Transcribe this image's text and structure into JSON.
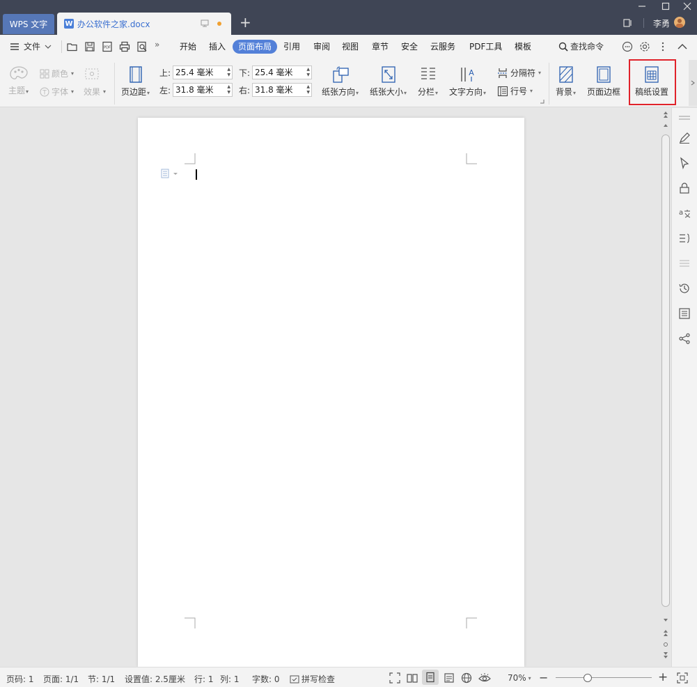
{
  "titlebar": {
    "app_tab": "WPS 文字",
    "doc_tab": "办公软件之家.docx",
    "doc_icon_letter": "W",
    "new_tab": "+",
    "user_name": "李勇",
    "unsaved_color": "#f0a030"
  },
  "menubar": {
    "file_label": "文件",
    "tabs": [
      "开始",
      "插入",
      "页面布局",
      "引用",
      "审阅",
      "视图",
      "章节",
      "安全",
      "云服务",
      "PDF工具",
      "模板"
    ],
    "active_tab": "页面布局",
    "search_label": "查找命令",
    "more": "»"
  },
  "ribbon": {
    "theme": "主题",
    "color": "颜色",
    "font": "字体",
    "effect": "效果",
    "margins": "页边距",
    "top_label": "上:",
    "top_value": "25.4 毫米",
    "bottom_label": "下:",
    "bottom_value": "25.4 毫米",
    "left_label": "左:",
    "left_value": "31.8 毫米",
    "right_label": "右:",
    "right_value": "31.8 毫米",
    "orientation": "纸张方向",
    "size": "纸张大小",
    "columns": "分栏",
    "text_direction": "文字方向",
    "separator": "分隔符",
    "line_number": "行号",
    "background": "背景",
    "page_border": "页面边框",
    "manuscript": "稿纸设置",
    "highlight_color": "#e0222a"
  },
  "statusbar": {
    "page_no": "页码: 1",
    "pages": "页面: 1/1",
    "section": "节: 1/1",
    "setting": "设置值: 2.5厘米",
    "row": "行: 1",
    "col": "列: 1",
    "words": "字数: 0",
    "spell": "拼写检查",
    "zoom": "70%",
    "zoom_minus": "−",
    "zoom_plus": "+"
  }
}
